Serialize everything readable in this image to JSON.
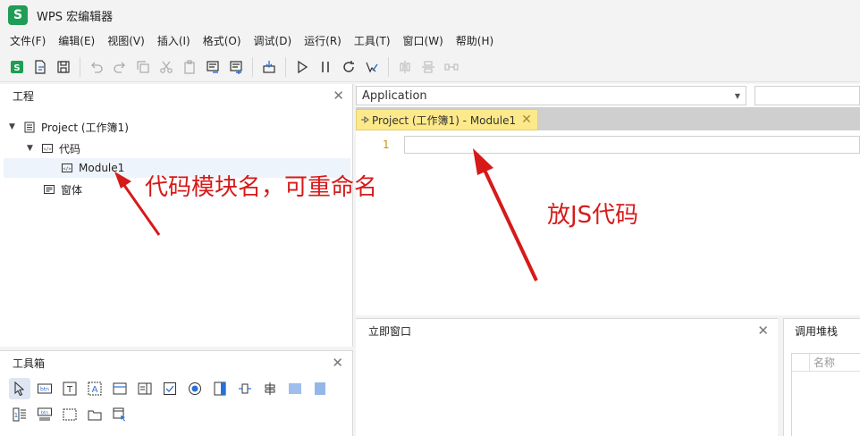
{
  "window": {
    "app_icon_letter": "S",
    "title": "WPS 宏编辑器"
  },
  "menubar": {
    "items": [
      "文件(F)",
      "编辑(E)",
      "视图(V)",
      "插入(I)",
      "格式(O)",
      "调试(D)",
      "运行(R)",
      "工具(T)",
      "窗口(W)",
      "帮助(H)"
    ]
  },
  "project_panel": {
    "title": "工程",
    "close_glyph": "✕",
    "tree": {
      "project": "Project (工作簿1)",
      "code_folder": "代码",
      "module": "Module1",
      "forms_folder": "窗体"
    }
  },
  "toolbox_panel": {
    "title": "工具箱",
    "close_glyph": "✕"
  },
  "editor": {
    "object_dropdown": "Application",
    "tab_label": "Project (工作簿1) - Module1",
    "tab_close_glyph": "✕",
    "line_number": "1"
  },
  "immediate_panel": {
    "title": "立即窗口",
    "close_glyph": "✕"
  },
  "callstack_panel": {
    "title": "调用堆栈",
    "column_name": "名称"
  },
  "annotations": {
    "module_note": "代码模块名，可重命名",
    "code_note": "放JS代码"
  },
  "colors": {
    "accent_green": "#1f9d55",
    "annotation_red": "#d61a1a",
    "tab_yellow": "#fde98a"
  }
}
